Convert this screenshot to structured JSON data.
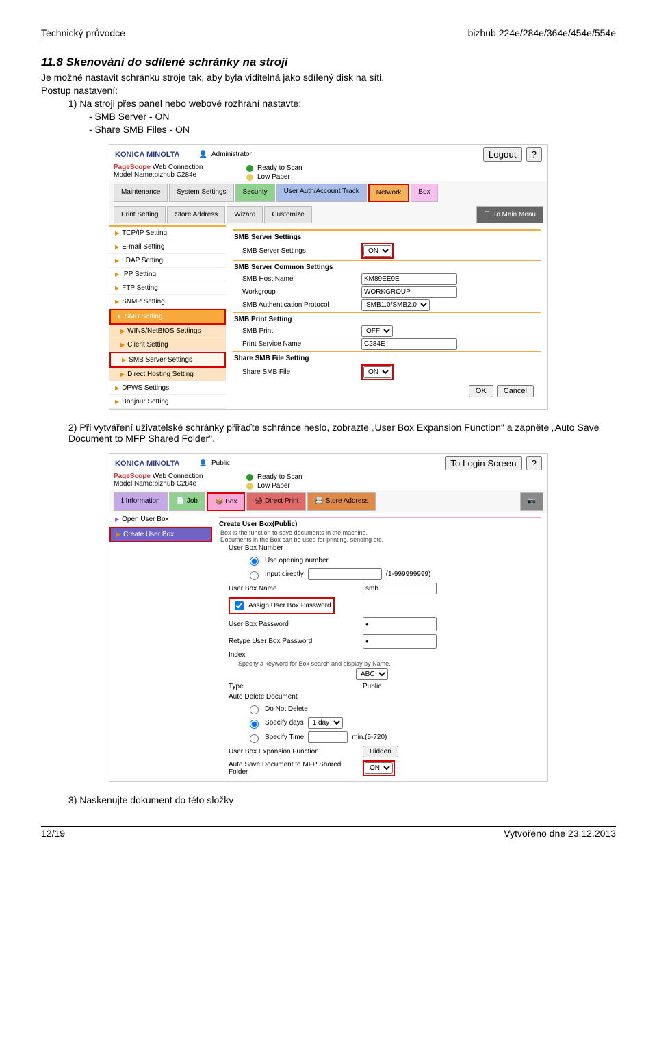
{
  "header": {
    "left": "Technický průvodce",
    "right": "bizhub 224e/284e/364e/454e/554e"
  },
  "footer": {
    "left": "12/19",
    "right": "Vytvořeno dne 23.12.2013"
  },
  "h_11_8": "11.8  Skenování do sdílené schránky na stroji",
  "p_intro": "Je možné nastavit schránku stroje tak, aby byla viditelná jako sdílený disk na síti.",
  "p_setup": "Postup nastavení:",
  "p_step1": "1)  Na stroji přes panel nebo webové rozhraní nastavte:",
  "p_step1a": "-    SMB Server  - ON",
  "p_step1b": "-    Share SMB Files - ON",
  "panel1": {
    "brand": "KONICA MINOLTA",
    "webconn": "Web Connection",
    "model": "Model Name:bizhub C284e",
    "user": "Administrator",
    "status_ready": "Ready to Scan",
    "status_paper": "Low Paper",
    "logout": "Logout",
    "help": "?",
    "tabs": [
      "Maintenance",
      "System Settings",
      "Security",
      "User Auth/Account Track",
      "Network",
      "Box"
    ],
    "subtabs": [
      "Print Setting",
      "Store Address",
      "Wizard",
      "Customize"
    ],
    "tomain": "To Main Menu",
    "side": [
      "TCP/IP Setting",
      "E-mail Setting",
      "LDAP Setting",
      "IPP Setting",
      "FTP Setting",
      "SNMP Setting",
      "SMB Setting"
    ],
    "side_sub": [
      "WINS/NetBIOS Settings",
      "Client Setting",
      "SMB Server Settings",
      "Direct Hosting Setting"
    ],
    "side2": [
      "DPWS Settings",
      "Bonjour Setting"
    ],
    "grp1": "SMB Server Settings",
    "r1": "SMB Server Settings",
    "r1v": "ON",
    "grp2": "SMB Server Common Settings",
    "r2": "SMB Host Name",
    "r2v": "KM89EE9E",
    "r3": "Workgroup",
    "r3v": "WORKGROUP",
    "r4": "SMB Authentication Protocol",
    "r4v": "SMB1.0/SMB2.0",
    "grp3": "SMB Print Setting",
    "r5": "SMB Print",
    "r5v": "OFF",
    "r6": "Print Service Name",
    "r6v": "C284E",
    "grp4": "Share SMB File Setting",
    "r7": "Share SMB File",
    "r7v": "ON",
    "ok": "OK",
    "cancel": "Cancel"
  },
  "p_step2": "2)  Při vytváření uživatelské schránky přiřaďte schránce heslo, zobrazte „User Box Expansion Function\" a zapněte „Auto Save Document to MFP Shared Folder\".",
  "panel2": {
    "brand": "KONICA MINOLTA",
    "webconn": "Web Connection",
    "model": "Model Name:bizhub C284e",
    "user": "Public",
    "status_ready": "Ready to Scan",
    "status_paper": "Low Paper",
    "login": "To Login Screen",
    "help": "?",
    "tabs": [
      "Information",
      "Job",
      "Box",
      "Direct Print",
      "Store Address"
    ],
    "side_open": "Open User Box",
    "side_create": "Create User Box",
    "title": "Create User Box(Public)",
    "desc1": "Box is the function to save documents in the machine.",
    "desc2": "Documents in the Box can be used for printing, sending etc.",
    "r1": "User Box Number",
    "r1a": "Use opening number",
    "r1b": "Input directly",
    "r1b_hint": "(1-999999999)",
    "r2": "User Box Name",
    "r2v": "smb",
    "r3": "Assign User Box Password",
    "r4": "User Box Password",
    "r5": "Retype User Box Password",
    "r6": "Index",
    "r6d": "Specify a keyword for Box search and display by Name.",
    "r6v": "ABC",
    "r7": "Type",
    "r7v": "Public",
    "r8": "Auto Delete Document",
    "r8a": "Do Not Delete",
    "r8b": "Specify days",
    "r8bv": "1 day",
    "r8c": "Specify Time",
    "r8c_hint": "min.(5-720)",
    "r9": "User Box Expansion Function",
    "r9v": "Hidden",
    "r10": "Auto Save Document to MFP Shared Folder",
    "r10v": "ON"
  },
  "p_step3": "3)  Naskenujte dokument do této složky"
}
